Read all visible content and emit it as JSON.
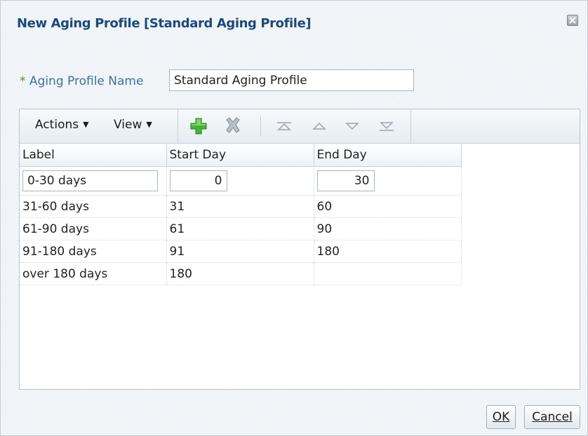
{
  "dialog": {
    "title": "New Aging Profile [Standard Aging Profile]",
    "close_icon": "close-x-icon"
  },
  "form": {
    "required_marker": "*",
    "name_label": "Aging Profile Name",
    "name_value": "Standard Aging Profile"
  },
  "toolbar": {
    "actions_label": "Actions",
    "view_label": "View",
    "icons": [
      "add-icon",
      "delete-icon",
      "move-top-icon",
      "move-up-icon",
      "move-down-icon",
      "move-bottom-icon"
    ]
  },
  "table": {
    "columns": [
      "Label",
      "Start Day",
      "End Day"
    ],
    "rows": [
      {
        "label": "0-30 days",
        "start": "0",
        "end": "30"
      },
      {
        "label": "31-60 days",
        "start": "31",
        "end": "60"
      },
      {
        "label": "61-90 days",
        "start": "61",
        "end": "90"
      },
      {
        "label": "91-180 days",
        "start": "91",
        "end": "180"
      },
      {
        "label": "over 180 days",
        "start": "180",
        "end": ""
      }
    ]
  },
  "buttons": {
    "ok_label": "OK",
    "cancel_label": "Cancel"
  },
  "colors": {
    "title": "#1b4a7a",
    "label": "#3d6fa3",
    "add_icon": "#3aa82c",
    "delete_icon": "#9aa2aa"
  }
}
